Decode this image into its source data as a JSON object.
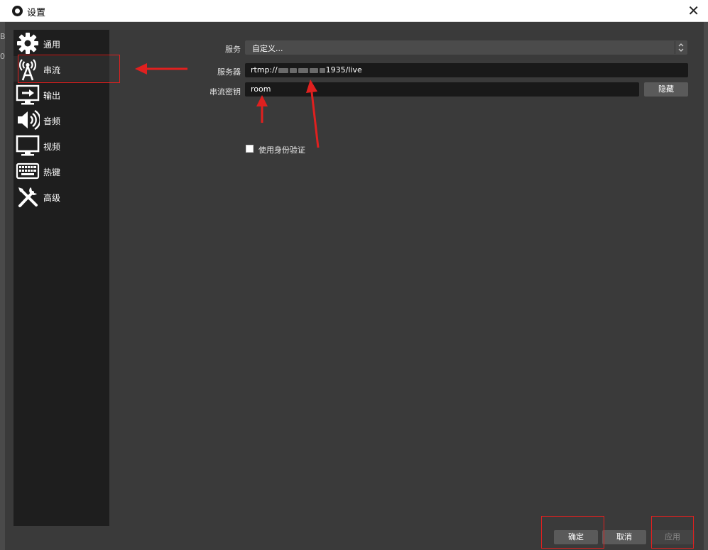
{
  "window": {
    "title": "设置",
    "close_glyph": "✕"
  },
  "background_window": {
    "edge_text_1": "B",
    "edge_text_2": "0"
  },
  "sidebar": {
    "items": [
      {
        "label": "通用",
        "icon": "gear-icon"
      },
      {
        "label": "串流",
        "icon": "broadcast-antenna-icon",
        "selected": true
      },
      {
        "label": "输出",
        "icon": "output-monitor-icon"
      },
      {
        "label": "音频",
        "icon": "speaker-icon"
      },
      {
        "label": "视频",
        "icon": "monitor-icon"
      },
      {
        "label": "热键",
        "icon": "keyboard-icon"
      },
      {
        "label": "高级",
        "icon": "tools-icon"
      }
    ]
  },
  "stream": {
    "service_label": "服务",
    "service_value": "自定义...",
    "server_label": "服务器",
    "server_prefix": "rtmp://",
    "server_suffix": "1935/live",
    "key_label": "串流密钥",
    "key_value": "room",
    "hide_button": "隐藏",
    "auth_checkbox_label": "使用身份验证",
    "auth_checked": false
  },
  "buttons": {
    "ok": "确定",
    "cancel": "取消",
    "apply": "应用"
  },
  "colors": {
    "annotation_red": "#e0201f",
    "panel_bg": "#3a3a3a",
    "sidebar_bg": "#1e1e1e"
  }
}
